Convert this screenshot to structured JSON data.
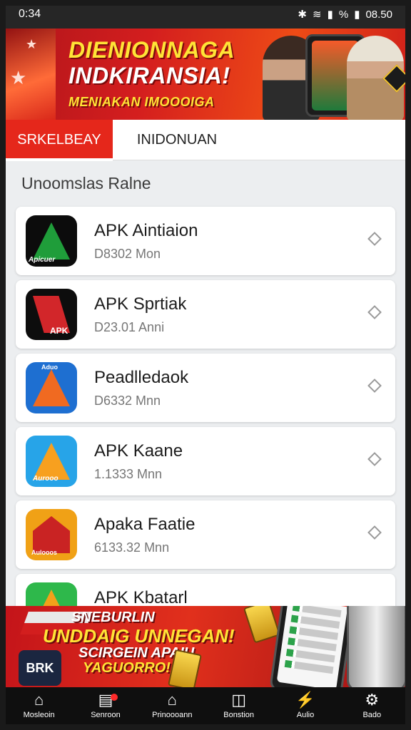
{
  "status_bar": {
    "left": "0:34",
    "right": "08.50",
    "battery_text": "%"
  },
  "hero": {
    "line1": "DIENIONNAGA",
    "line2": "INDKIRANSIA!",
    "line3": "MENIAKAN IMOOOIGA"
  },
  "tabs": [
    {
      "label": "SRKELBEAY",
      "active": true
    },
    {
      "label": "INIDONUAN",
      "active": false
    }
  ],
  "section_title": "Unoomslas Ralne",
  "apps": [
    {
      "name": "APK Aintiaion",
      "meta": "D8302 Mon",
      "icon_label": "Apicuer",
      "color_a": "#1f9d3a",
      "color_b": "#0c0c0c"
    },
    {
      "name": "APK Sprtiak",
      "meta": "D23.01 Anni",
      "icon_label": "APK",
      "color_a": "#0d0d0d",
      "color_b": "#d2262a"
    },
    {
      "name": "Peadlledaok",
      "meta": "D6332 Mnn",
      "icon_label": "Aduo",
      "color_a": "#1e6fd1",
      "color_b": "#f06a21"
    },
    {
      "name": "APK Kaane",
      "meta": "1.1333 Mnn",
      "icon_label": "Aurooo",
      "color_a": "#27a4e8",
      "color_b": "#f7a01f"
    },
    {
      "name": "Apaka Faatie",
      "meta": "6133.32 Mnn",
      "icon_label": "Aulooos",
      "color_a": "#f0a116",
      "color_b": "#c92323"
    },
    {
      "name": "APK Kbatarl",
      "meta": "",
      "icon_label": "",
      "color_a": "#2eb84b",
      "color_b": "#f2a11a"
    }
  ],
  "promo": {
    "line1": "SNEBURLIN",
    "line2": "UNDDAIG UNNEGAN!",
    "line3": "SCIRGEIN APAIU",
    "line4": "YAGUORRO!",
    "app_label": "BRK"
  },
  "bottom_nav": [
    {
      "label": "Mosleoin",
      "icon": "home-icon"
    },
    {
      "label": "Senroon",
      "icon": "store-icon"
    },
    {
      "label": "Prinoooann",
      "icon": "building-icon"
    },
    {
      "label": "Bonstion",
      "icon": "compass-icon"
    },
    {
      "label": "Aulio",
      "icon": "flash-icon"
    },
    {
      "label": "Bado",
      "icon": "settings-icon"
    }
  ]
}
